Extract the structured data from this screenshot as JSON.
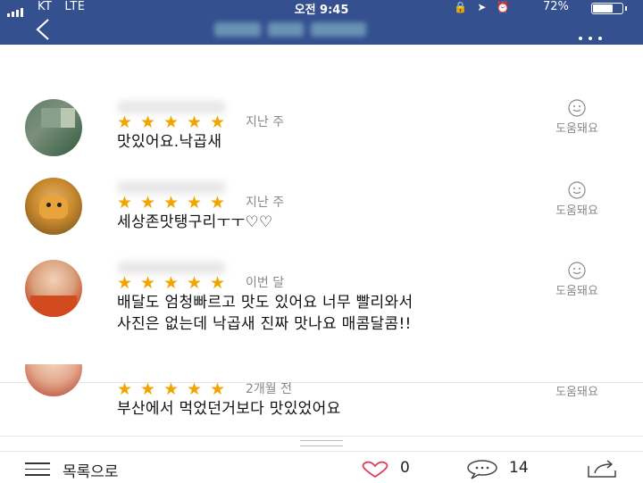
{
  "status_bar": {
    "carrier": "KT",
    "network": "LTE",
    "time": "오전 9:45",
    "battery": "72%",
    "battery_level": 0.72
  },
  "nav": {
    "back_icon": "chevron-left-icon",
    "more_icon": "ellipsis-icon"
  },
  "reviews": [
    {
      "rating": 5,
      "time_ago": "지난 주",
      "text": "맛있어요.낙곱새",
      "helpful_label": "도움돼요"
    },
    {
      "rating": 5,
      "time_ago": "지난 주",
      "text": "세상존맛탱구리ㅜㅜ♡♡",
      "helpful_label": "도움돼요"
    },
    {
      "rating": 5,
      "time_ago": "이번 달",
      "text_lines": [
        "배달도 엄청빠르고 맛도 있어요 너무 빨리와서",
        "사진은 없는데 낙곱새 진짜 맛나요 매콤달콤!!"
      ],
      "helpful_label": "도움돼요"
    },
    {
      "rating": 5,
      "time_ago": "2개월 전",
      "text": "부산에서 먹었던거보다 맛있었어요",
      "helpful_label": "도움돼요"
    }
  ],
  "bottom_bar": {
    "list_label": "목록으로",
    "like_count": "0",
    "comment_count": "14"
  },
  "colors": {
    "header_bg": "#34508f",
    "star": "#f0a500",
    "like_heart": "#e0405a"
  }
}
